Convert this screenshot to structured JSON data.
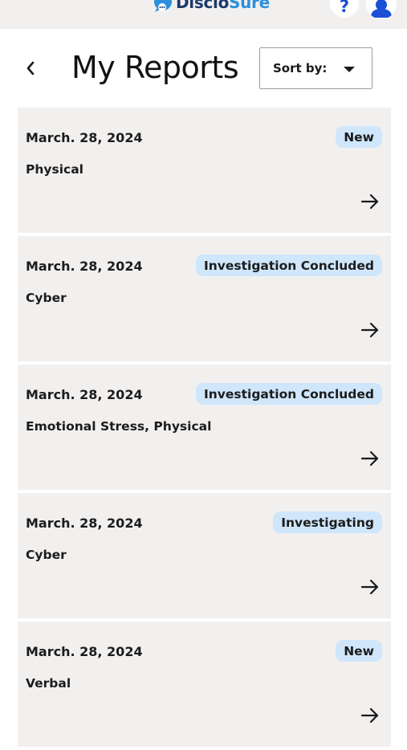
{
  "app": {
    "brand_part1": "Disclo",
    "brand_part2": "Sure",
    "help_label": "?",
    "brand_colors": {
      "navy": "#1b3a6b",
      "blue": "#2c8fdc"
    }
  },
  "header": {
    "title": "My Reports",
    "sort_label": "Sort by:"
  },
  "reports": [
    {
      "date": "March. 28, 2024",
      "type": "Physical",
      "status": "New"
    },
    {
      "date": "March. 28, 2024",
      "type": "Cyber",
      "status": "Investigation Concluded"
    },
    {
      "date": "March. 28, 2024",
      "type": "Emotional Stress, Physical",
      "status": "Investigation Concluded"
    },
    {
      "date": "March. 28, 2024",
      "type": "Cyber",
      "status": "Investigating"
    },
    {
      "date": "March. 28, 2024",
      "type": "Verbal",
      "status": "New"
    }
  ],
  "icons": {
    "back": "chevron-left-icon",
    "sort": "caret-down-icon",
    "open": "arrow-right-icon",
    "help": "question-icon",
    "user": "user-icon"
  },
  "colors": {
    "card_bg": "#f2f0ef",
    "badge_bg": "#cfe6fb",
    "help_blue": "#1a4fd6"
  }
}
